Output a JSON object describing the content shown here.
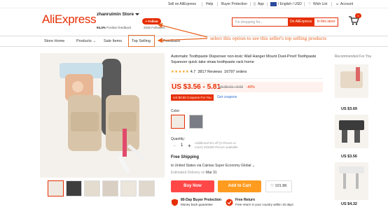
{
  "top_nav": {
    "sell": "Sell on AliExpress",
    "help": "Help",
    "buyer_protection": "Buyer Protection",
    "app": "App",
    "language": "/ English / USD",
    "wishlist": "Wish List",
    "account": "Account"
  },
  "header": {
    "logo": "AliExpress",
    "store_name": "zhanruimin Store",
    "follow": "+ Follow",
    "positive_feedback": "94.4%",
    "positive_feedback_label": "Positive feedback",
    "followers": "2035 Followers",
    "search_placeholder": "I'm shopping for...",
    "search_on_aliexpress": "On AliExpress",
    "search_in_store": "In this store",
    "cart_count": "0"
  },
  "store_nav": {
    "items": [
      "Store Home",
      "Products",
      "Sale Items",
      "Top Selling",
      "Feedback"
    ]
  },
  "annotation": "select this option to see this seller's top selling products",
  "product": {
    "title": "Automatic Toothpaste Dispenser non-toxic Wall Hanger Mount Dust-Proof Toothpaste Squeezer quick take straw toothpaste rack home",
    "stars": "★★★★★",
    "rating": "4.7",
    "reviews": "3817 Reviews",
    "orders": "16797 orders",
    "price": "US $3.56 - 5.81",
    "original_price": "US $5.91 - 9.68",
    "discount": "-40%",
    "coupon": "US $3.50 Coupons For You",
    "get_coupons": "Get coupons",
    "color_label": "Color:",
    "quantity_label": "Quantity:",
    "quantity": "1",
    "availability": "Additional 5% off (2 Pieces or more) 203290 Pieces available",
    "shipping_title": "Free Shipping",
    "shipping_dest": "to United States via Cainiao Super Economy Global",
    "eta_label": "Estimated Delivery on",
    "eta_date": "Mar 31",
    "buy_now": "Buy Now",
    "add_to_cart": "Add to Cart",
    "wishlist_count": "101.8K",
    "guarantee1_title": "80-Day Buyer Protection",
    "guarantee1_sub": "Money back guarantee",
    "guarantee2_title": "Free Return",
    "guarantee2_sub": "Free return in your country within 15 days"
  },
  "recommended": {
    "title": "Recommended For You",
    "prices": [
      "US $3.69",
      "US $3.56",
      "",
      "US $4.32"
    ]
  },
  "colors": {
    "brand": "#e62e04",
    "buy": "#ff4747",
    "cart": "#ff9b1f",
    "annotation": "#e8601c"
  }
}
